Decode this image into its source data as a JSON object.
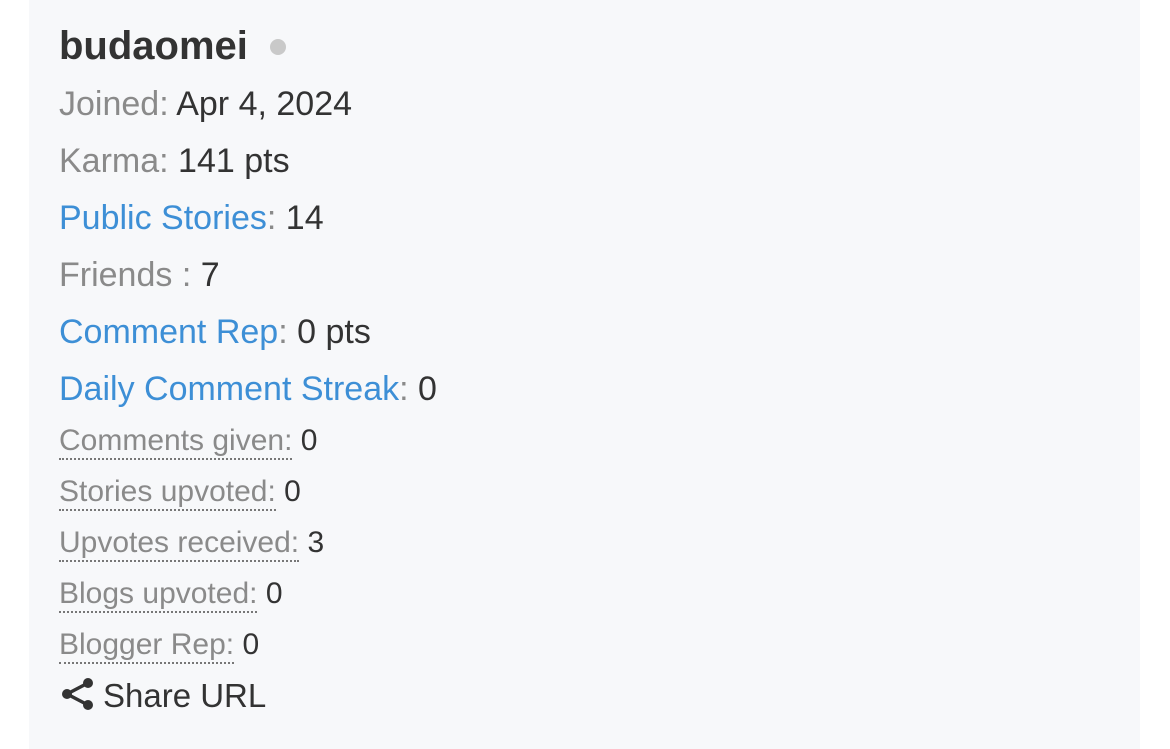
{
  "profile": {
    "username": "budaomei",
    "status": "offline"
  },
  "stats": {
    "joined_label": "Joined:",
    "joined_value": "Apr 4, 2024",
    "karma_label": "Karma:",
    "karma_value": "141 pts",
    "public_stories_label": "Public Stories",
    "public_stories_value": "14",
    "friends_label": "Friends :",
    "friends_value": "7",
    "comment_rep_label": "Comment Rep",
    "comment_rep_value": "0 pts",
    "daily_streak_label": "Daily Comment Streak",
    "daily_streak_value": "0"
  },
  "activity": {
    "comments_given_label": "Comments given:",
    "comments_given_value": "0",
    "stories_upvoted_label": "Stories upvoted:",
    "stories_upvoted_value": "0",
    "upvotes_received_label": "Upvotes received:",
    "upvotes_received_value": "3",
    "blogs_upvoted_label": "Blogs upvoted:",
    "blogs_upvoted_value": "0",
    "blogger_rep_label": "Blogger Rep:",
    "blogger_rep_value": "0"
  },
  "share": {
    "label": "Share URL",
    "icon": "share-icon"
  },
  "colors": {
    "card_background": "#f7f8fa",
    "link": "#3d8fd6",
    "label": "#8a8a8a",
    "value": "#333333",
    "status_dot": "#c9c9c9"
  }
}
